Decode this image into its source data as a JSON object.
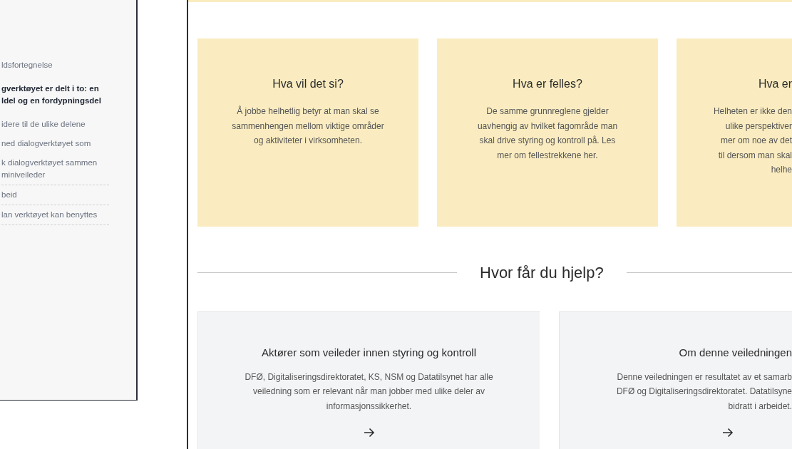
{
  "sidebar": {
    "items": [
      {
        "lines": [
          "ldsfortegnelse"
        ],
        "selected": false,
        "divider": false
      },
      {
        "lines": [
          "gverktøyet er delt i to: en",
          "ldel og en fordypningsdel"
        ],
        "selected": true,
        "divider": false
      },
      {
        "lines": [
          "idere til de ulike delene"
        ],
        "selected": false,
        "divider": false
      },
      {
        "lines": [
          "ned dialogverktøyet som"
        ],
        "selected": false,
        "divider": false
      },
      {
        "lines": [
          "k dialogverktøyet sammen",
          "miniveileder"
        ],
        "selected": false,
        "divider": true
      },
      {
        "lines": [
          "beid"
        ],
        "selected": false,
        "divider": true
      },
      {
        "lines": [
          "lan verktøyet kan benyttes"
        ],
        "selected": false,
        "divider": true
      }
    ]
  },
  "info_cards": [
    {
      "title": "Hva vil det si?",
      "lines": [
        "Å jobbe helhetlig betyr at man skal se",
        "sammenhengen mellom viktige områder",
        "og aktiviteter i virksomheten."
      ]
    },
    {
      "title": "Hva er felles?",
      "lines": [
        "De samme grunnreglene gjelder",
        "uavhengig av hvilket fagområde man",
        "skal drive styring og kontroll på. Les",
        "mer om fellestrekkene her."
      ]
    },
    {
      "title": "Hva er",
      "lines": [
        "Helheten er ikke den",
        "ulike perspektiver",
        "mer om noe av det",
        "til dersom man skal",
        "helhe"
      ]
    }
  ],
  "help_section": {
    "heading": "Hvor får du hjelp?",
    "cards": [
      {
        "title": "Aktører som veileder innen styring og kontroll",
        "lines": [
          "DFØ, Digitaliseringsdirektoratet, KS, NSM og Datatilsynet har alle",
          "veiledning som er relevant når man jobber med ulike deler av",
          "informasjonssikkerhet."
        ]
      },
      {
        "title": "Om denne veiledningen",
        "lines": [
          "Denne veiledningen er resultatet av et samarb",
          "DFØ og Digitaliseringsdirektoratet. Datatilsyne",
          "bidratt i arbeidet."
        ]
      }
    ]
  }
}
